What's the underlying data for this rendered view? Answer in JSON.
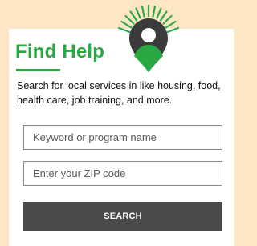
{
  "widget": {
    "title": "Find Help",
    "description": "Search for local services in like housing, food, health care, job training, and more.",
    "keyword_placeholder": "Keyword or program name",
    "zip_placeholder": "Enter your ZIP code",
    "search_label": "SEARCH"
  },
  "colors": {
    "background": "#fde6c4",
    "accent_green": "#2aa844",
    "button": "#4a4a4a",
    "logo_dark": "#3b3b3b"
  },
  "icons": {
    "logo": "location-pin-person-icon"
  }
}
